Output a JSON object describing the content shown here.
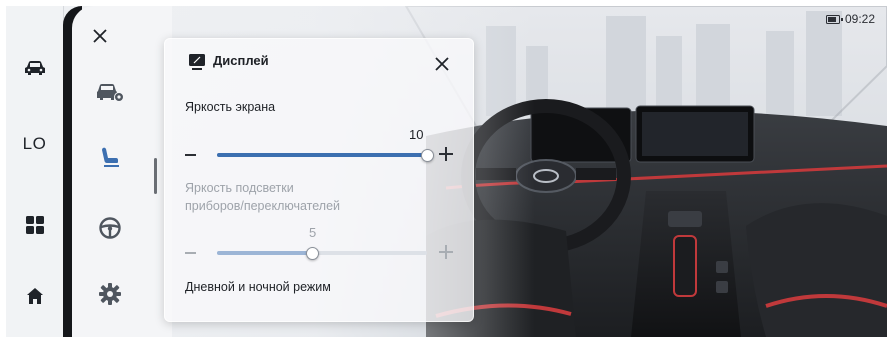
{
  "status": {
    "time": "09:22",
    "battery_icon": "battery-icon"
  },
  "rail": {
    "items": [
      {
        "name": "rail-car",
        "icon": "car-icon"
      },
      {
        "name": "rail-lo",
        "label": "LO"
      },
      {
        "name": "rail-apps",
        "icon": "apps-grid-icon"
      },
      {
        "name": "rail-home",
        "icon": "home-icon"
      }
    ]
  },
  "sidebar": {
    "close_icon": "close-icon",
    "items": [
      {
        "icon": "car-settings-icon"
      },
      {
        "icon": "seat-icon",
        "active": true
      },
      {
        "icon": "steering-wheel-icon"
      },
      {
        "icon": "gear-icon"
      }
    ]
  },
  "panel": {
    "title": "Дисплей",
    "title_icon": "display-icon",
    "screen_brightness": {
      "label": "Яркость экрана",
      "value": "10",
      "level": 1.0,
      "min": 0,
      "max": 10
    },
    "backlight_brightness": {
      "label_line1": "Яркость подсветки",
      "label_line2": "приборов/переключателей",
      "value": "5",
      "level": 0.45
    },
    "day_night_label": "Дневной и ночной режим"
  },
  "colors": {
    "accent": "#3c6fb0",
    "accent_red": "#c0393b",
    "rail_bg": "#f1f3f5",
    "divider": "#15171a"
  }
}
